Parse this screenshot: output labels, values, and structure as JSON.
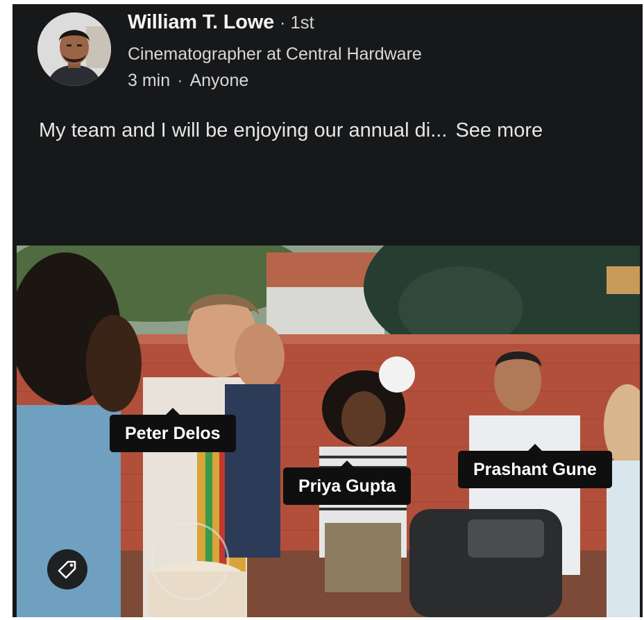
{
  "author": {
    "name": "William T. Lowe",
    "degree": "· 1st",
    "headline": "Cinematographer at Central Hardware",
    "time": "3 min",
    "separator": "·",
    "visibility": "Anyone"
  },
  "post": {
    "text": "My team and I will be enjoying our annual di...",
    "see_more": "See more"
  },
  "photo": {
    "tags": [
      {
        "name": "Peter Delos"
      },
      {
        "name": "Priya Gupta"
      },
      {
        "name": "Prashant Gune"
      }
    ],
    "tag_button_icon": "tag-icon"
  },
  "colors": {
    "background": "#17181a",
    "text": "#f4f4f4",
    "tag_bg": "#0f0f10"
  }
}
